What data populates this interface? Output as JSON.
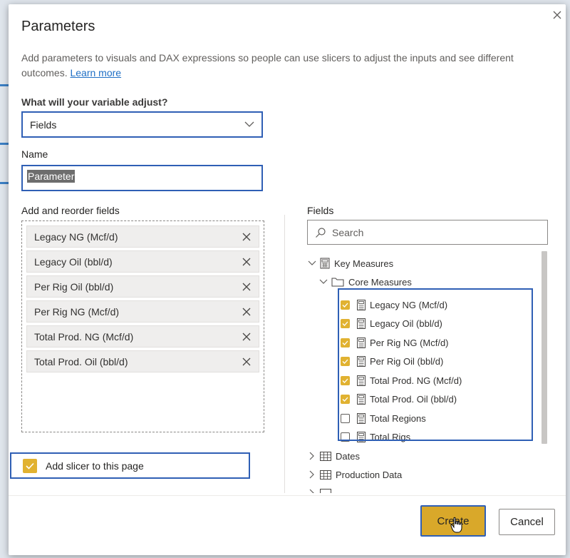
{
  "dialog": {
    "title": "Parameters",
    "description": "Add parameters to visuals and DAX expressions so people can use slicers to adjust the inputs and see different outcomes.",
    "learn_more": "Learn more"
  },
  "variable": {
    "label": "What will your variable adjust?",
    "value": "Fields"
  },
  "name": {
    "label": "Name",
    "value": "Parameter"
  },
  "reorder": {
    "label": "Add and reorder fields",
    "items": [
      "Legacy NG (Mcf/d)",
      "Legacy Oil (bbl/d)",
      "Per Rig Oil (bbl/d)",
      "Per Rig NG (Mcf/d)",
      "Total Prod. NG (Mcf/d)",
      "Total Prod. Oil (bbl/d)"
    ]
  },
  "slicer": {
    "label": "Add slicer to this page",
    "checked": true
  },
  "fields_panel": {
    "label": "Fields",
    "search_placeholder": "Search",
    "tree": {
      "table": "Key Measures",
      "folder": "Core Measures",
      "measures": [
        {
          "label": "Legacy NG (Mcf/d)",
          "checked": true
        },
        {
          "label": "Legacy Oil (bbl/d)",
          "checked": true
        },
        {
          "label": "Per Rig NG (Mcf/d)",
          "checked": true
        },
        {
          "label": "Per Rig Oil (bbl/d)",
          "checked": true
        },
        {
          "label": "Total Prod. NG (Mcf/d)",
          "checked": true
        },
        {
          "label": "Total Prod. Oil (bbl/d)",
          "checked": true
        },
        {
          "label": "Total Regions",
          "checked": false
        },
        {
          "label": "Total Rigs",
          "checked": false
        }
      ],
      "other_tables": [
        "Dates",
        "Production Data"
      ]
    }
  },
  "buttons": {
    "create": "Create",
    "cancel": "Cancel"
  },
  "colors": {
    "accent_yellow": "#e1b231",
    "highlight_blue": "#2f5fb5",
    "link": "#1f6fc5"
  }
}
